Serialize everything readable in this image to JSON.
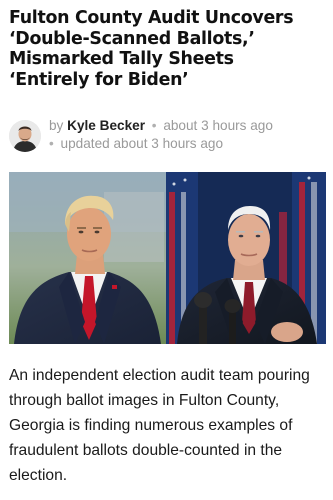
{
  "article": {
    "headline_lines": [
      "Fulton County Audit Uncovers",
      "‘Double-Scanned Ballots,’",
      "Mismarked Tally Sheets",
      "‘Entirely for Biden’"
    ],
    "byline": {
      "by_label": "by",
      "author": "Kyle Becker",
      "separator": "•",
      "published": "about 3 hours ago",
      "updated": "updated about 3 hours ago",
      "avatar_icon": "author-avatar"
    },
    "image": {
      "left_panel": "trump-photo",
      "right_panel": "biden-photo"
    },
    "lede_lines": [
      "An independent election audit team pouring",
      "through ballot images in Fulton County,",
      "Georgia is finding numerous examples of",
      "fraudulent ballots double-counted in the",
      "election."
    ]
  },
  "colors": {
    "text": "#111111",
    "meta_gray": "#9a9a9a",
    "background": "#ffffff"
  }
}
